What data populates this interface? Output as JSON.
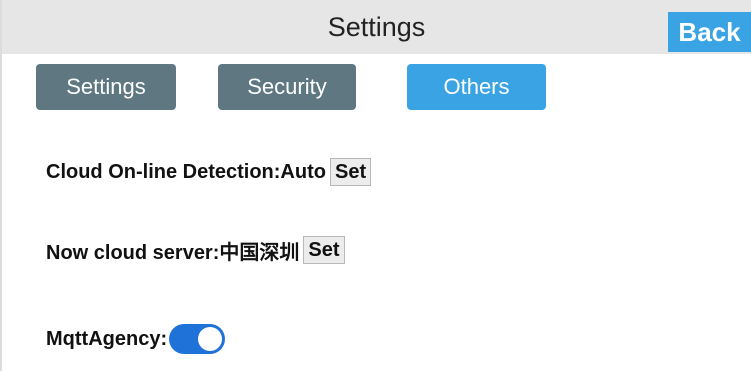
{
  "header": {
    "title": "Settings",
    "back_label": "Back"
  },
  "tabs": [
    {
      "label": "Settings",
      "active": false
    },
    {
      "label": "Security",
      "active": false
    },
    {
      "label": "Others",
      "active": true
    }
  ],
  "rows": {
    "cloud_detection": {
      "label": "Cloud On-line Detection:Auto",
      "button": "Set"
    },
    "cloud_server": {
      "label": "Now cloud server:中国深圳",
      "button": "Set"
    },
    "mqtt": {
      "label": "MqttAgency:",
      "enabled": true
    }
  },
  "colors": {
    "accent": "#3aa3e3",
    "tab_inactive": "#5f7780",
    "toggle_on": "#1f73d8",
    "header_bg": "#e6e6e6"
  }
}
